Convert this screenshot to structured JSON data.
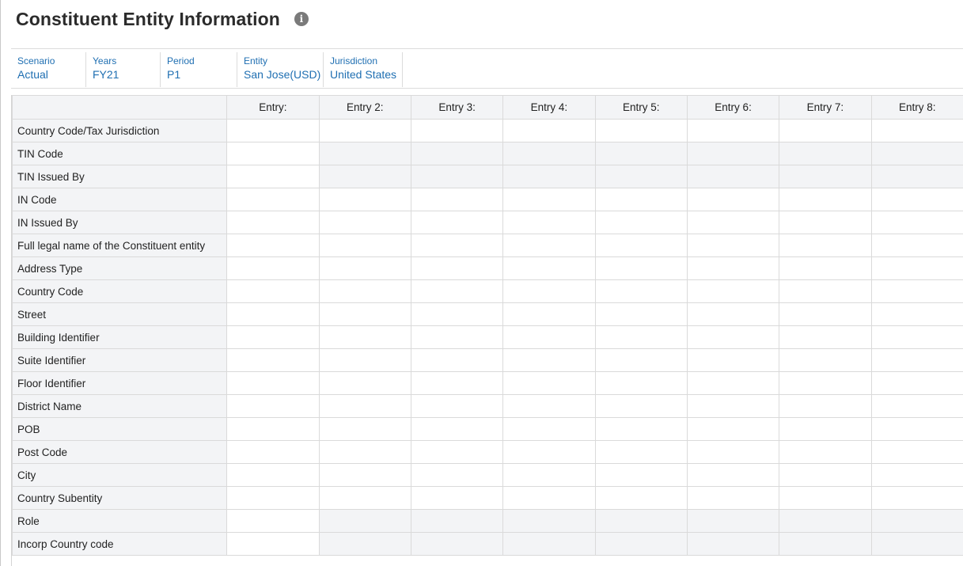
{
  "page": {
    "title": "Constituent Entity Information",
    "info_icon": "info-circle-icon"
  },
  "pov": [
    {
      "label": "Scenario",
      "value": "Actual"
    },
    {
      "label": "Years",
      "value": "FY21"
    },
    {
      "label": "Period",
      "value": "P1"
    },
    {
      "label": "Entity",
      "value": "San Jose(USD)"
    },
    {
      "label": "Jurisdiction",
      "value": "United States"
    }
  ],
  "grid": {
    "corner_label": "",
    "columns": [
      "Entry:",
      "Entry 2:",
      "Entry 3:",
      "Entry 4:",
      "Entry 5:",
      "Entry 6:",
      "Entry 7:",
      "Entry 8:"
    ],
    "rows": [
      {
        "label": "Country Code/Tax Jurisdiction",
        "shaded_from_col": null
      },
      {
        "label": "TIN Code",
        "shaded_from_col": 1
      },
      {
        "label": "TIN Issued By",
        "shaded_from_col": 1
      },
      {
        "label": "IN Code",
        "shaded_from_col": null
      },
      {
        "label": "IN Issued By",
        "shaded_from_col": null
      },
      {
        "label": "Full legal name of the Constituent entity",
        "shaded_from_col": null
      },
      {
        "label": "Address Type",
        "shaded_from_col": null
      },
      {
        "label": "Country Code",
        "shaded_from_col": null
      },
      {
        "label": "Street",
        "shaded_from_col": null
      },
      {
        "label": "Building Identifier",
        "shaded_from_col": null
      },
      {
        "label": "Suite Identifier",
        "shaded_from_col": null
      },
      {
        "label": "Floor Identifier",
        "shaded_from_col": null
      },
      {
        "label": "District Name",
        "shaded_from_col": null
      },
      {
        "label": "POB",
        "shaded_from_col": null
      },
      {
        "label": "Post Code",
        "shaded_from_col": null
      },
      {
        "label": "City",
        "shaded_from_col": null
      },
      {
        "label": "Country Subentity",
        "shaded_from_col": null
      },
      {
        "label": "Role",
        "shaded_from_col": 1
      },
      {
        "label": "Incorp Country code",
        "shaded_from_col": 1
      }
    ]
  },
  "colors": {
    "link_blue": "#1f6fb2",
    "header_bg": "#f3f4f6",
    "border": "#dadada"
  }
}
